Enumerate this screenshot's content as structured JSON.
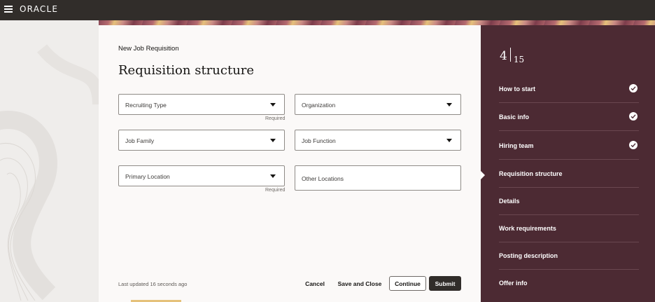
{
  "header": {
    "brand": "ORACLE"
  },
  "main": {
    "eyebrow": "New Job Requisition",
    "title": "Requisition structure",
    "fields": {
      "recruiting_type": {
        "label": "Recruiting Type",
        "required": "Required"
      },
      "organization": {
        "label": "Organization"
      },
      "job_family": {
        "label": "Job Family"
      },
      "job_function": {
        "label": "Job Function"
      },
      "primary_location": {
        "label": "Primary Location",
        "required": "Required"
      },
      "other_locations": {
        "label": "Other Locations"
      }
    },
    "last_updated": "Last updated 16 seconds ago",
    "buttons": {
      "cancel": "Cancel",
      "save_close": "Save and Close",
      "continue": "Continue",
      "submit": "Submit"
    }
  },
  "progress": {
    "current": "4",
    "total": "15",
    "steps": [
      {
        "label": "How to start",
        "done": true
      },
      {
        "label": "Basic info",
        "done": true
      },
      {
        "label": "Hiring team",
        "done": true
      },
      {
        "label": "Requisition structure",
        "current": true
      },
      {
        "label": "Details"
      },
      {
        "label": "Work requirements"
      },
      {
        "label": "Posting description"
      },
      {
        "label": "Offer info"
      }
    ]
  },
  "colors": {
    "topbar": "#312d2a",
    "rail": "#4c2a33",
    "primary_button": "#312d2a"
  },
  "icons": [
    "hamburger-icon",
    "dropdown-caret-icon",
    "check-circle-icon"
  ]
}
